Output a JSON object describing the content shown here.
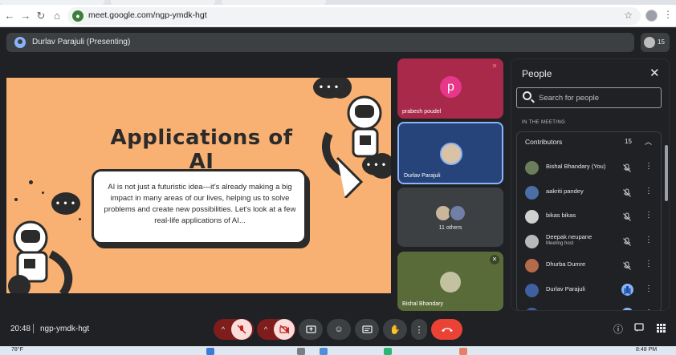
{
  "browser": {
    "url": "meet.google.com/ngp-ymdk-hgt"
  },
  "meet": {
    "presenting_label": "Durlav Parajuli (Presenting)",
    "participant_count": "15",
    "meeting_time": "20:48",
    "meeting_code": "ngp-ymdk-hgt"
  },
  "slide": {
    "title": "Applications of AI",
    "body": "AI is not just a futuristic idea—it's already making a big impact in many areas of our lives, helping us to solve problems and create new possibilities. Let's look at a few real-life applications of AI..."
  },
  "tiles": [
    {
      "name": "prabesh poudel",
      "initial": "p"
    },
    {
      "name": "Durlav Parajuli"
    },
    {
      "label": "11 others"
    },
    {
      "name": "Bishal Bhandary"
    }
  ],
  "people_panel": {
    "title": "People",
    "search_placeholder": "Search for people",
    "section_label": "IN THE MEETING",
    "group_label": "Contributors",
    "group_count": "15",
    "participants": [
      {
        "name": "Bishal Bhandary (You)",
        "avatar_color": "#6b7d5a"
      },
      {
        "name": "aakriti pandey",
        "avatar_color": "#4a6fa5"
      },
      {
        "name": "bikas bikas",
        "avatar_color": "#d0d0d0"
      },
      {
        "name": "Deepak neupane",
        "sub": "Meeting host",
        "avatar_color": "#b9b9b9"
      },
      {
        "name": "Dhurba Dumre",
        "avatar_color": "#b56a4a"
      },
      {
        "name": "Durlav Parajuli",
        "avatar_color": "#3f5fa0"
      },
      {
        "name": "Durlav Parajuli",
        "avatar_color": "#3f5fa0"
      }
    ]
  },
  "taskbar": {
    "weather": "78°F",
    "time": "8:48 PM"
  },
  "colors": {
    "slide_bg": "#f8b073",
    "leave_red": "#ea4335",
    "accent_blue": "#8ab4f8"
  }
}
